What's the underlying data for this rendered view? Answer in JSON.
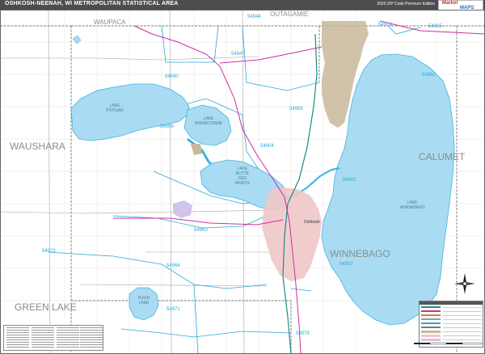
{
  "header": {
    "title": "OSHKOSH-NEENAH, WI METROPOLITAN STATISTICAL AREA",
    "edition": "2020 ZIP Code Premium Edition"
  },
  "logo": {
    "text_a": "Market",
    "text_b": "MAPS"
  },
  "counties": [
    {
      "id": "waupaca",
      "name": "WAUPACA"
    },
    {
      "id": "outagamie",
      "name": "OUTAGAMIE"
    },
    {
      "id": "waushara",
      "name": "WAUSHARA"
    },
    {
      "id": "calumet",
      "name": "CALUMET"
    },
    {
      "id": "winnebago",
      "name": "WINNEBAGO"
    },
    {
      "id": "green-lake",
      "name": "GREEN LAKE"
    }
  ],
  "zips": [
    "54944",
    "54914",
    "54915",
    "54947",
    "54952",
    "54940",
    "54956",
    "54986",
    "54904",
    "54901",
    "54963",
    "54902",
    "54964",
    "54923",
    "54971",
    "54979"
  ],
  "lakes": {
    "poygan": [
      "LAKE",
      "POYGAN"
    ],
    "winneconne": [
      "LAKE",
      "WINNECONNE"
    ],
    "butte": [
      "LAKE",
      "BUTTE",
      "DES",
      "MORTS"
    ],
    "winnebago": [
      "LAKE",
      "WINNEBAGO"
    ],
    "rush": [
      "RUSH",
      "LAKE"
    ]
  },
  "cities": {
    "oshkosh": "Oshkosh"
  },
  "colors": {
    "water": "#a9dcf2",
    "water_edge": "#3eb1e3",
    "urban": "#c8b89b",
    "urban_pink": "#efc6c8",
    "purple_area": "#d0c4ea",
    "zip_line": "#2aa7d8",
    "highway": "#cc2e9e",
    "road_gray": "#9b9b9b",
    "county_line": "#7a7a7a"
  },
  "icons": [
    "compass-rose-icon",
    "market-maps-logo"
  ]
}
